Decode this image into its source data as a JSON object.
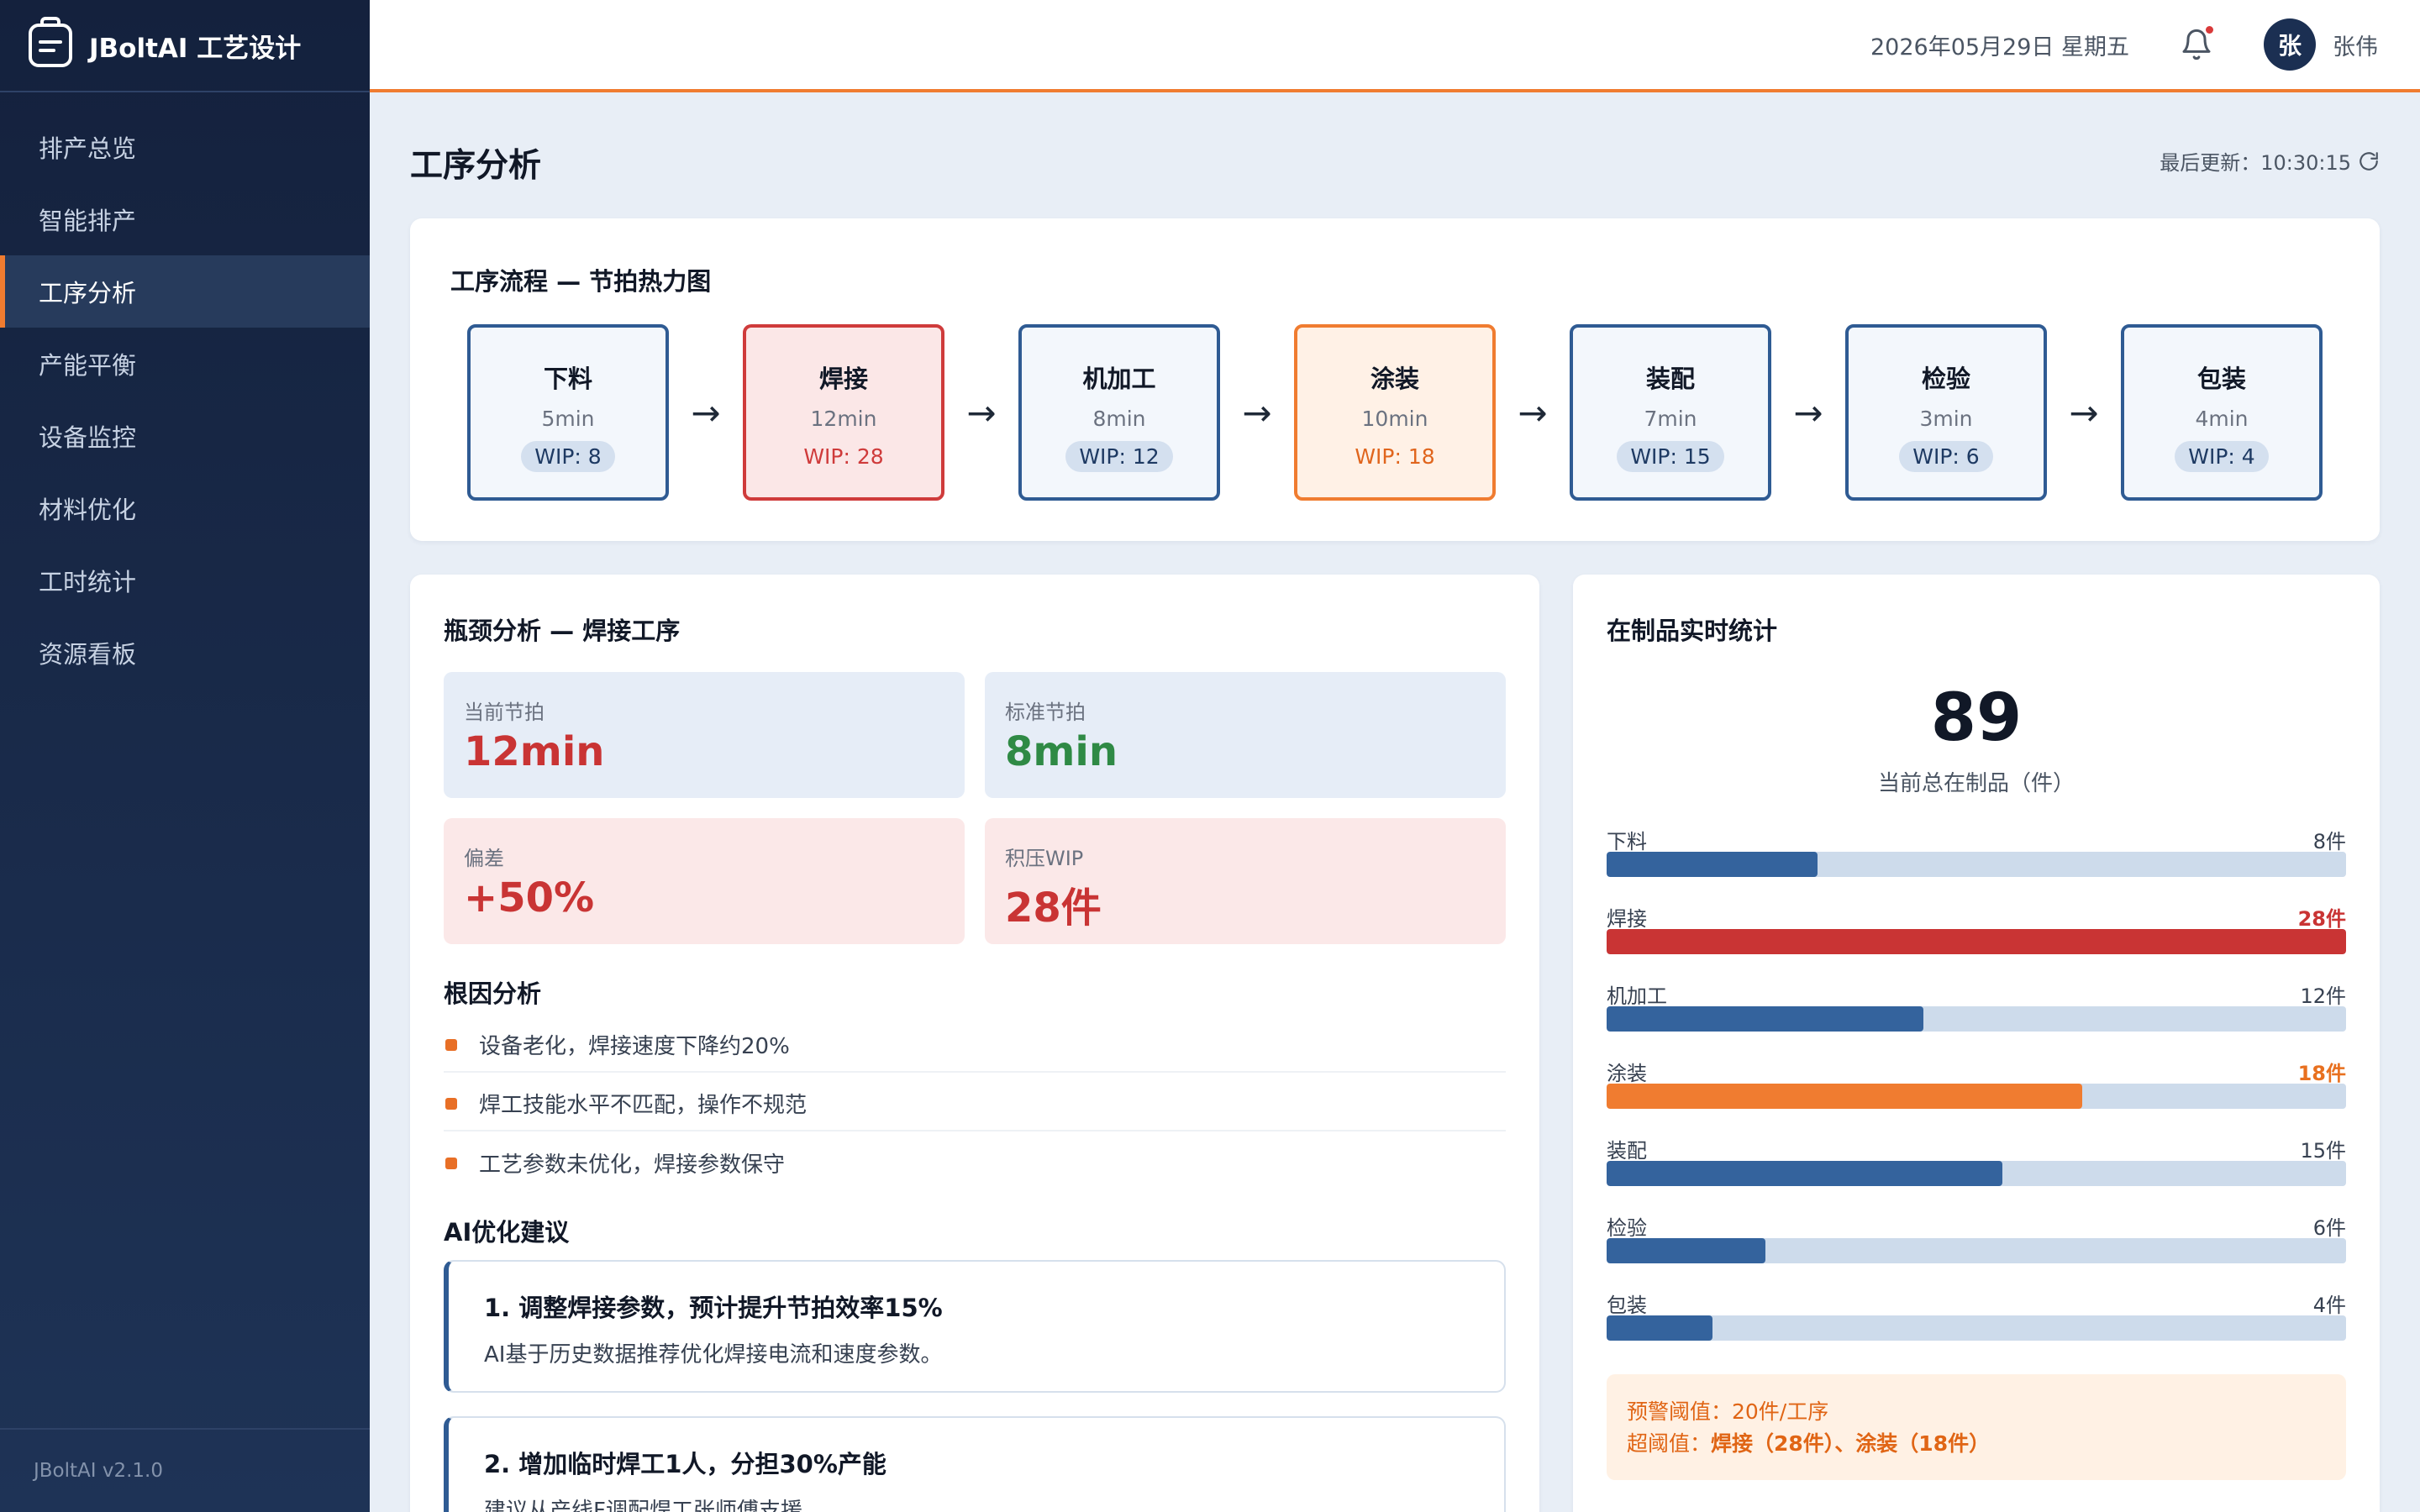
{
  "brand": {
    "name": "JBoltAI 工艺设计"
  },
  "sidebar": {
    "items": [
      {
        "label": "排产总览",
        "name": "sidebar-item-schedule-overview"
      },
      {
        "label": "智能排产",
        "name": "sidebar-item-smart-scheduling"
      },
      {
        "label": "工序分析",
        "name": "sidebar-item-process-analysis",
        "active": true
      },
      {
        "label": "产能平衡",
        "name": "sidebar-item-capacity-balance"
      },
      {
        "label": "设备监控",
        "name": "sidebar-item-equipment-monitor"
      },
      {
        "label": "材料优化",
        "name": "sidebar-item-material-optimization"
      },
      {
        "label": "工时统计",
        "name": "sidebar-item-labor-hours"
      },
      {
        "label": "资源看板",
        "name": "sidebar-item-resource-board"
      }
    ],
    "version": "JBoltAI v2.1.0"
  },
  "header": {
    "date": "2026年05月29日 星期五",
    "avatar_initial": "张",
    "user_name": "张伟"
  },
  "page": {
    "title": "工序分析",
    "last_update": "最后更新：10:30:15"
  },
  "flow": {
    "title": "工序流程 — 节拍热力图",
    "steps": [
      {
        "name": "下料",
        "time": "5min",
        "wip": "WIP: 8",
        "level": "normal"
      },
      {
        "name": "焊接",
        "time": "12min",
        "wip": "WIP: 28",
        "level": "hot"
      },
      {
        "name": "机加工",
        "time": "8min",
        "wip": "WIP: 12",
        "level": "normal"
      },
      {
        "name": "涂装",
        "time": "10min",
        "wip": "WIP: 18",
        "level": "warm"
      },
      {
        "name": "装配",
        "time": "7min",
        "wip": "WIP: 15",
        "level": "normal"
      },
      {
        "name": "检验",
        "time": "3min",
        "wip": "WIP: 6",
        "level": "normal"
      },
      {
        "name": "包装",
        "time": "4min",
        "wip": "WIP: 4",
        "level": "normal"
      }
    ],
    "arrow": "→"
  },
  "bottleneck": {
    "title": "瓶颈分析 — 焊接工序",
    "metrics": {
      "current": {
        "label": "当前节拍",
        "value": "12min"
      },
      "standard": {
        "label": "标准节拍",
        "value": "8min"
      },
      "deviation": {
        "label": "偏差",
        "value": "+50%"
      },
      "backlog": {
        "label": "积压WIP",
        "value": "28件"
      }
    },
    "causes_title": "根因分析",
    "causes": [
      "设备老化，焊接速度下降约20%",
      "焊工技能水平不匹配，操作不规范",
      "工艺参数未优化，焊接参数保守"
    ],
    "suggestions_title": "AI优化建议",
    "suggestions": [
      {
        "title": "1. 调整焊接参数，预计提升节拍效率15%",
        "desc": "AI基于历史数据推荐优化焊接电流和速度参数。"
      },
      {
        "title": "2. 增加临时焊工1人，分担30%产能",
        "desc": "建议从产线F调配焊工张师傅支援。"
      }
    ]
  },
  "wip": {
    "title": "在制品实时统计",
    "total": "89",
    "total_label": "当前总在制品（件）",
    "bars": [
      {
        "name": "下料",
        "value_label": "8件",
        "value": 8,
        "status": "normal"
      },
      {
        "name": "焊接",
        "value_label": "28件",
        "value": 28,
        "status": "red"
      },
      {
        "name": "机加工",
        "value_label": "12件",
        "value": 12,
        "status": "normal"
      },
      {
        "name": "涂装",
        "value_label": "18件",
        "value": 18,
        "status": "orange"
      },
      {
        "name": "装配",
        "value_label": "15件",
        "value": 15,
        "status": "normal"
      },
      {
        "name": "检验",
        "value_label": "6件",
        "value": 6,
        "status": "normal"
      },
      {
        "name": "包装",
        "value_label": "4件",
        "value": 4,
        "status": "normal"
      }
    ],
    "scale_max": 28,
    "warn_threshold": "预警阈值：20件/工序",
    "warn_exceed_prefix": "超阈值：",
    "warn_exceed_items": "焊接（28件）、涂装（18件）"
  },
  "colors": {
    "accent": "#f07c30",
    "sidebar": "#14213d",
    "danger": "#c93434",
    "ok": "#2f8a45",
    "bar": "#34639d"
  }
}
